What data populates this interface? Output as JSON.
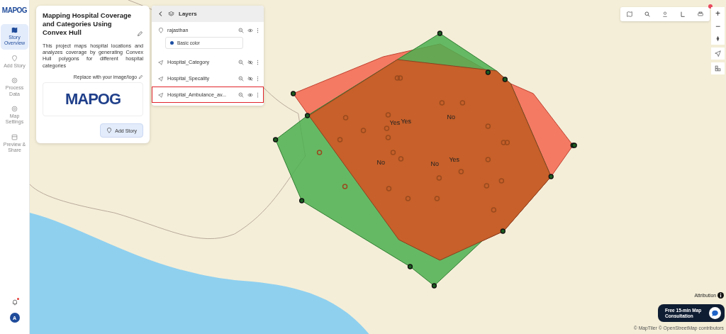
{
  "app_logo": {
    "text": "MAPOG"
  },
  "nav_items": [
    {
      "label": "Story Overview",
      "selected": true
    },
    {
      "label": "Add Story",
      "selected": false
    },
    {
      "label": "Process Data",
      "selected": false
    },
    {
      "label": "Map Settings",
      "selected": false
    },
    {
      "label": "Preview & Share",
      "selected": false
    }
  ],
  "user": {
    "initial": "A",
    "notification": true
  },
  "story_panel": {
    "title": "Mapping Hospital Coverage and Categories Using Convex Hull",
    "description": "This project maps hospital locations and analyzes coverage by generating Convex Hull polygons for different hospital categories",
    "replace_label": "Replace with your image/logo",
    "logo_text": "MAPOG",
    "add_button": "Add Story"
  },
  "layers_panel": {
    "title": "Layers",
    "layers": [
      {
        "name": "rajasthan",
        "kind": "polygon",
        "visible": true,
        "highlighted": false,
        "legend": {
          "label": "Basic color",
          "color": "#1d4fa3"
        }
      },
      {
        "name": "Hospital_Category",
        "kind": "point",
        "visible": false,
        "highlighted": false
      },
      {
        "name": "Hospital_Specality",
        "kind": "point",
        "visible": false,
        "highlighted": false
      },
      {
        "name": "Hospital_Ambulance_av...",
        "kind": "point",
        "visible": true,
        "highlighted": true
      }
    ]
  },
  "map": {
    "labels": [
      "Yes",
      "Yes",
      "No",
      "No",
      "No",
      "Yes"
    ]
  },
  "map_controls": {
    "zoom_in": "+",
    "zoom_out": "−",
    "notification": true
  },
  "attribution": {
    "label": "Attribution",
    "credits": "© MapTiler © OpenStreetMap contributors"
  },
  "consultation_button": "Free 15-min Map Consultation"
}
